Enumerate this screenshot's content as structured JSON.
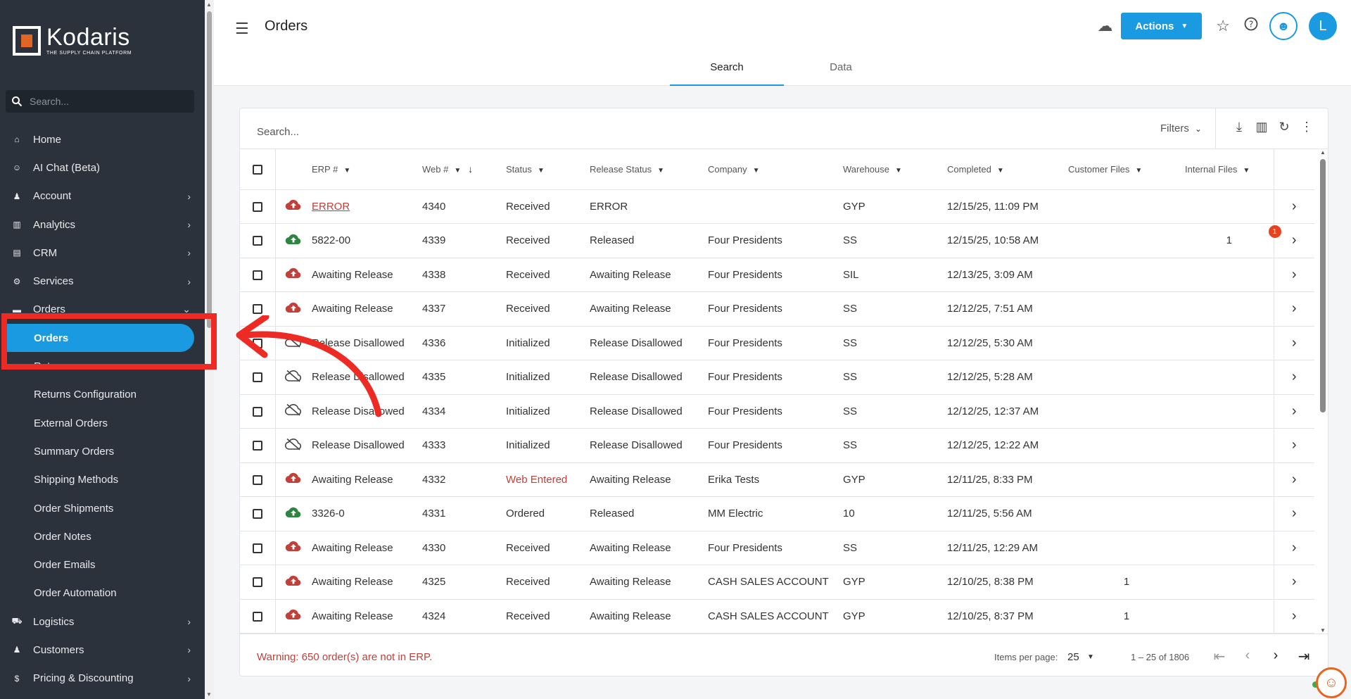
{
  "sidebar": {
    "logo": {
      "name": "Kodaris",
      "tagline": "THE SUPPLY CHAIN PLATFORM"
    },
    "search_placeholder": "Search...",
    "items": [
      {
        "label": "Home",
        "icon": "home-icon",
        "glyph": "⌂",
        "chevron": ""
      },
      {
        "label": "AI Chat (Beta)",
        "icon": "robot-icon",
        "glyph": "☺",
        "chevron": ""
      },
      {
        "label": "Account",
        "icon": "person-icon",
        "glyph": "♟",
        "chevron": "›"
      },
      {
        "label": "Analytics",
        "icon": "chart-icon",
        "glyph": "▥",
        "chevron": "›"
      },
      {
        "label": "CRM",
        "icon": "contact-card-icon",
        "glyph": "▤",
        "chevron": "›"
      },
      {
        "label": "Services",
        "icon": "gears-icon",
        "glyph": "⚙",
        "chevron": "›"
      },
      {
        "label": "Orders",
        "icon": "truck-icon",
        "glyph": "▬",
        "chevron": "⌄"
      }
    ],
    "sub_items": [
      {
        "label": "Orders",
        "active": true
      },
      {
        "label": "Returns"
      },
      {
        "label": "Returns Configuration"
      },
      {
        "label": "External Orders"
      },
      {
        "label": "Summary Orders"
      },
      {
        "label": "Shipping Methods"
      },
      {
        "label": "Order Shipments"
      },
      {
        "label": "Order Notes"
      },
      {
        "label": "Order Emails"
      },
      {
        "label": "Order Automation"
      }
    ],
    "bottom_items": [
      {
        "label": "Logistics",
        "icon": "truck-icon",
        "glyph": "⛟",
        "chevron": "›"
      },
      {
        "label": "Customers",
        "icon": "people-icon",
        "glyph": "♟",
        "chevron": "›"
      },
      {
        "label": "Pricing & Discounting",
        "icon": "dollar-icon",
        "glyph": "$",
        "chevron": "›"
      }
    ]
  },
  "header": {
    "title": "Orders",
    "actions_label": "Actions",
    "avatar_initial": "L",
    "tabs": [
      {
        "label": "Search",
        "active": true
      },
      {
        "label": "Data",
        "active": false
      }
    ]
  },
  "card": {
    "search_placeholder": "Search...",
    "filters_label": "Filters",
    "columns": [
      "ERP #",
      "Web #",
      "Status",
      "Release Status",
      "Company",
      "Warehouse",
      "Completed",
      "Customer Files",
      "Internal Files"
    ],
    "rows": [
      {
        "icon": "upload-error",
        "erp": "ERROR",
        "erp_link": true,
        "web": "4340",
        "status": "Received",
        "release": "ERROR",
        "company": "",
        "warehouse": "GYP",
        "completed": "12/15/25, 11:09 PM",
        "customer_files": "",
        "internal_files": "",
        "badge": ""
      },
      {
        "icon": "upload-ok",
        "erp": "5822-00",
        "web": "4339",
        "status": "Received",
        "release": "Released",
        "company": "Four Presidents",
        "warehouse": "SS",
        "completed": "12/15/25, 10:58 AM",
        "customer_files": "",
        "internal_files": "1",
        "badge": "1"
      },
      {
        "icon": "upload-error",
        "erp": "Awaiting Release",
        "web": "4338",
        "status": "Received",
        "release": "Awaiting Release",
        "company": "Four Presidents",
        "warehouse": "SIL",
        "completed": "12/13/25, 3:09 AM",
        "customer_files": "",
        "internal_files": "",
        "badge": ""
      },
      {
        "icon": "upload-error",
        "erp": "Awaiting Release",
        "web": "4337",
        "status": "Received",
        "release": "Awaiting Release",
        "company": "Four Presidents",
        "warehouse": "SS",
        "completed": "12/12/25, 7:51 AM",
        "customer_files": "",
        "internal_files": "",
        "badge": ""
      },
      {
        "icon": "cloud-off",
        "erp": "Release Disallowed",
        "web": "4336",
        "status": "Initialized",
        "release": "Release Disallowed",
        "company": "Four Presidents",
        "warehouse": "SS",
        "completed": "12/12/25, 5:30 AM",
        "customer_files": "",
        "internal_files": "",
        "badge": ""
      },
      {
        "icon": "cloud-off",
        "erp": "Release Disallowed",
        "web": "4335",
        "status": "Initialized",
        "release": "Release Disallowed",
        "company": "Four Presidents",
        "warehouse": "SS",
        "completed": "12/12/25, 5:28 AM",
        "customer_files": "",
        "internal_files": "",
        "badge": ""
      },
      {
        "icon": "cloud-off",
        "erp": "Release Disallowed",
        "web": "4334",
        "status": "Initialized",
        "release": "Release Disallowed",
        "company": "Four Presidents",
        "warehouse": "SS",
        "completed": "12/12/25, 12:37 AM",
        "customer_files": "",
        "internal_files": "",
        "badge": ""
      },
      {
        "icon": "cloud-off",
        "erp": "Release Disallowed",
        "web": "4333",
        "status": "Initialized",
        "release": "Release Disallowed",
        "company": "Four Presidents",
        "warehouse": "SS",
        "completed": "12/12/25, 12:22 AM",
        "customer_files": "",
        "internal_files": "",
        "badge": ""
      },
      {
        "icon": "upload-error",
        "erp": "Awaiting Release",
        "web": "4332",
        "status": "Web Entered",
        "status_red": true,
        "release": "Awaiting Release",
        "company": "Erika Tests",
        "warehouse": "GYP",
        "completed": "12/11/25, 8:33 PM",
        "customer_files": "",
        "internal_files": "",
        "badge": ""
      },
      {
        "icon": "upload-ok",
        "erp": "3326-0",
        "web": "4331",
        "status": "Ordered",
        "release": "Released",
        "company": "MM Electric",
        "warehouse": "10",
        "completed": "12/11/25, 5:56 AM",
        "customer_files": "",
        "internal_files": "",
        "badge": ""
      },
      {
        "icon": "upload-error",
        "erp": "Awaiting Release",
        "web": "4330",
        "status": "Received",
        "release": "Awaiting Release",
        "company": "Four Presidents",
        "warehouse": "SS",
        "completed": "12/11/25, 12:29 AM",
        "customer_files": "",
        "internal_files": "",
        "badge": ""
      },
      {
        "icon": "upload-error",
        "erp": "Awaiting Release",
        "web": "4325",
        "status": "Received",
        "release": "Awaiting Release",
        "company": "CASH SALES ACCOUNT",
        "warehouse": "GYP",
        "completed": "12/10/25, 8:38 PM",
        "customer_files": "1",
        "internal_files": "",
        "badge": ""
      },
      {
        "icon": "upload-error",
        "erp": "Awaiting Release",
        "web": "4324",
        "status": "Received",
        "release": "Awaiting Release",
        "company": "CASH SALES ACCOUNT",
        "warehouse": "GYP",
        "completed": "12/10/25, 8:37 PM",
        "customer_files": "1",
        "internal_files": "",
        "badge": ""
      }
    ],
    "warning": "Warning: 650 order(s) are not in ERP.",
    "items_per_page_label": "Items per page:",
    "items_per_page": "25",
    "range": "1 – 25 of 1806"
  },
  "colors": {
    "accent": "#1a9be1",
    "sidebar": "#2b323c",
    "error": "#c0403a",
    "success": "#2e8540",
    "annotation": "#ee2a24"
  }
}
